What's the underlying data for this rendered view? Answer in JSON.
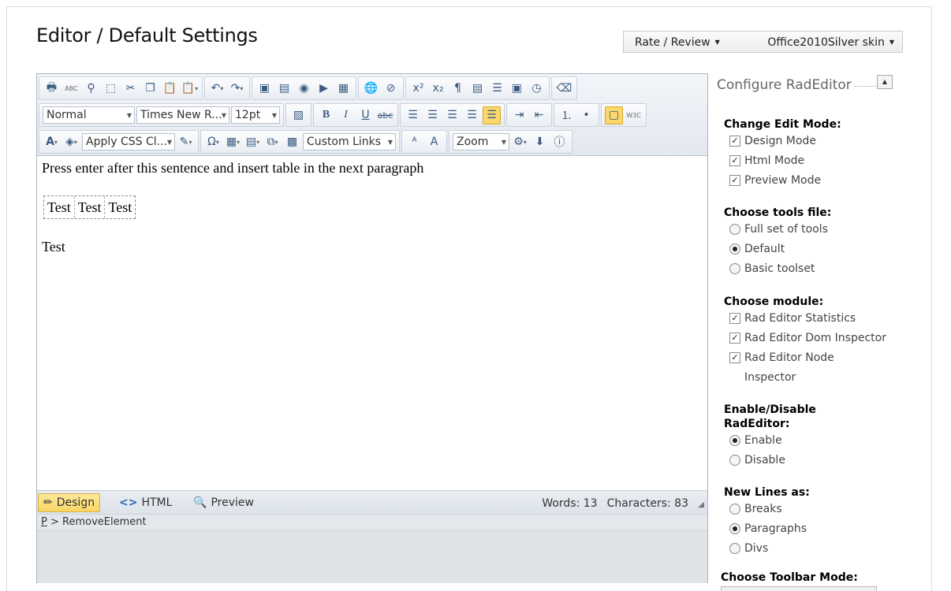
{
  "page": {
    "title": "Editor / Default Settings"
  },
  "topbar": {
    "rate_label": "Rate / Review",
    "skin_label": "Office2010Silver skin"
  },
  "toolbar": {
    "row1": [
      "print-icon",
      "spellcheck-icon",
      "find-icon",
      "select-all-icon",
      "cut-icon",
      "copy-icon",
      "paste-icon",
      "paste-options-icon",
      "undo-icon",
      "redo-icon",
      "image-manager-icon",
      "document-manager-icon",
      "flash-manager-icon",
      "media-manager-icon",
      "template-manager-icon",
      "hyperlink-icon",
      "remove-link-icon",
      "superscript-icon",
      "subscript-icon",
      "paragraph-icon",
      "insert-date-icon",
      "insert-symbol-icon",
      "module-icon",
      "time-icon",
      "format-stripper-icon"
    ],
    "paragraph_style": "Normal",
    "font_name": "Times New R...",
    "font_size": "12pt",
    "apply_css": "Apply CSS Cl...",
    "custom_links": "Custom Links",
    "zoom": "Zoom"
  },
  "content": {
    "paragraph1": "Press enter after this sentence and insert table in the next paragraph",
    "table_cells": [
      "Test",
      "Test",
      "Test"
    ],
    "paragraph2": "Test"
  },
  "modes": {
    "design": "Design",
    "html": "HTML",
    "preview": "Preview"
  },
  "stats": {
    "words": "Words: 13",
    "characters": "Characters: 83"
  },
  "pathbar": {
    "tag": "P",
    "separator": ">",
    "element": "RemoveElement"
  },
  "config": {
    "title": "Configure RadEditor",
    "edit_mode": {
      "heading": "Change Edit Mode:",
      "options": [
        {
          "label": "Design Mode",
          "checked": true
        },
        {
          "label": "Html Mode",
          "checked": true
        },
        {
          "label": "Preview Mode",
          "checked": true
        }
      ]
    },
    "tools_file": {
      "heading": "Choose tools file:",
      "options": [
        {
          "label": "Full set of tools",
          "selected": false
        },
        {
          "label": "Default",
          "selected": true
        },
        {
          "label": "Basic toolset",
          "selected": false
        }
      ]
    },
    "module": {
      "heading": "Choose module:",
      "options": [
        {
          "label": "Rad Editor Statistics",
          "checked": true
        },
        {
          "label": "Rad Editor Dom Inspector",
          "checked": true
        },
        {
          "label": "Rad Editor Node",
          "label2": "Inspector",
          "checked": true
        }
      ]
    },
    "enable": {
      "heading": "Enable/Disable",
      "heading2": "RadEditor:",
      "options": [
        {
          "label": "Enable",
          "selected": true
        },
        {
          "label": "Disable",
          "selected": false
        }
      ]
    },
    "new_lines": {
      "heading": "New Lines as:",
      "options": [
        {
          "label": "Breaks",
          "selected": false
        },
        {
          "label": "Paragraphs",
          "selected": true
        },
        {
          "label": "Divs",
          "selected": false
        }
      ]
    },
    "toolbar_mode": {
      "heading": "Choose Toolbar Mode:"
    }
  }
}
